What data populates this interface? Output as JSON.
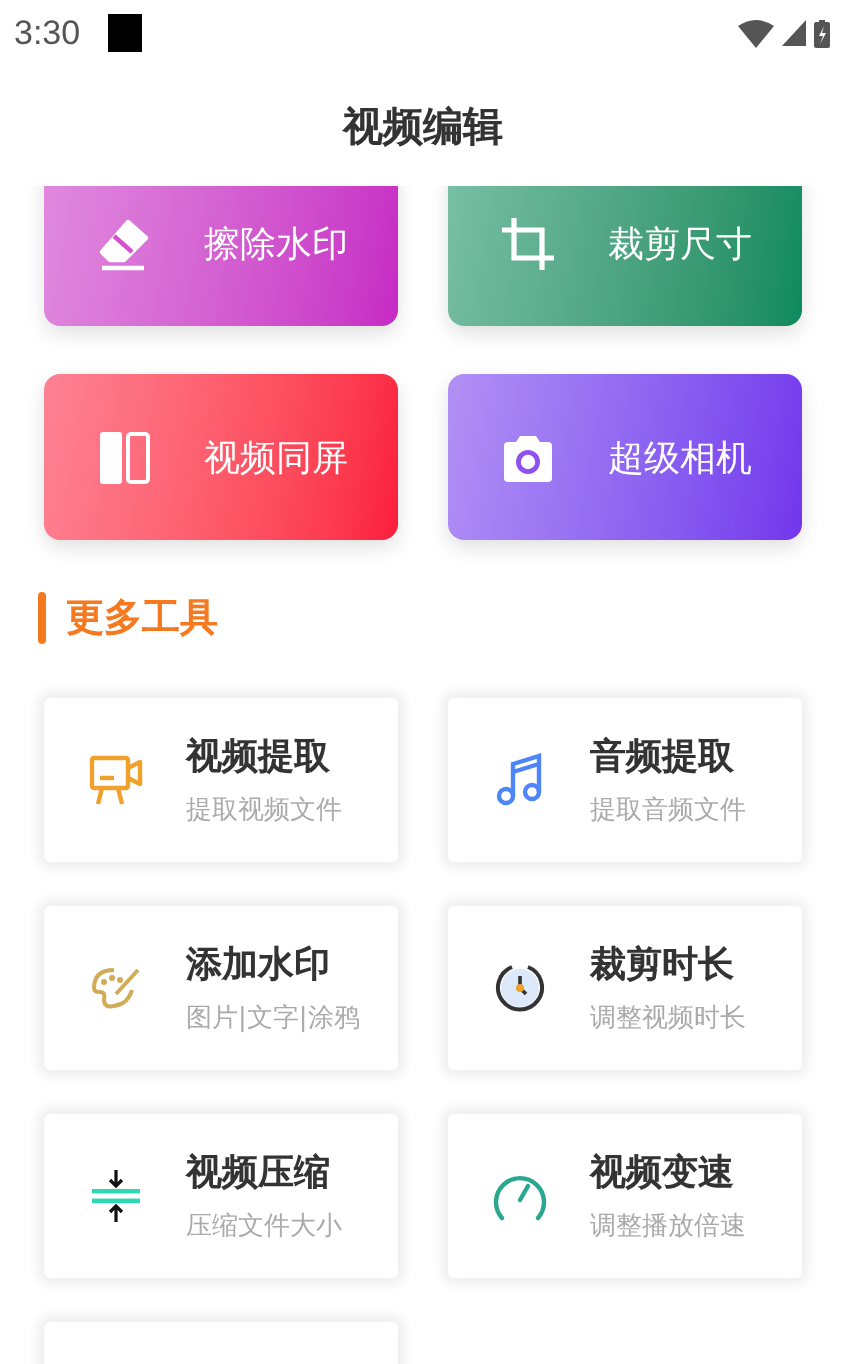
{
  "status_bar": {
    "time": "3:30"
  },
  "title": "视频编辑",
  "feature_tools": [
    {
      "label": "擦除水印",
      "color": "#c62ac4"
    },
    {
      "label": "裁剪尺寸",
      "color": "#0a8a5e"
    },
    {
      "label": "视频同屏",
      "color": "#fb1b3d"
    },
    {
      "label": "超级相机",
      "color": "#7335ec"
    }
  ],
  "more_tools": {
    "heading": "更多工具",
    "items": [
      {
        "kind": "tool",
        "title": "视频提取",
        "subtitle": "提取视频文件"
      },
      {
        "kind": "tool",
        "title": "音频提取",
        "subtitle": "提取音频文件"
      },
      {
        "kind": "tool",
        "title": "添加水印",
        "subtitle": "图片|文字|涂鸦"
      },
      {
        "kind": "tool",
        "title": "裁剪时长",
        "subtitle": "调整视频时长"
      },
      {
        "kind": "tool",
        "title": "视频压缩",
        "subtitle": "压缩文件大小"
      },
      {
        "kind": "tool",
        "title": "视频变速",
        "subtitle": "调整播放倍速"
      },
      {
        "kind": "cut_off"
      }
    ]
  }
}
